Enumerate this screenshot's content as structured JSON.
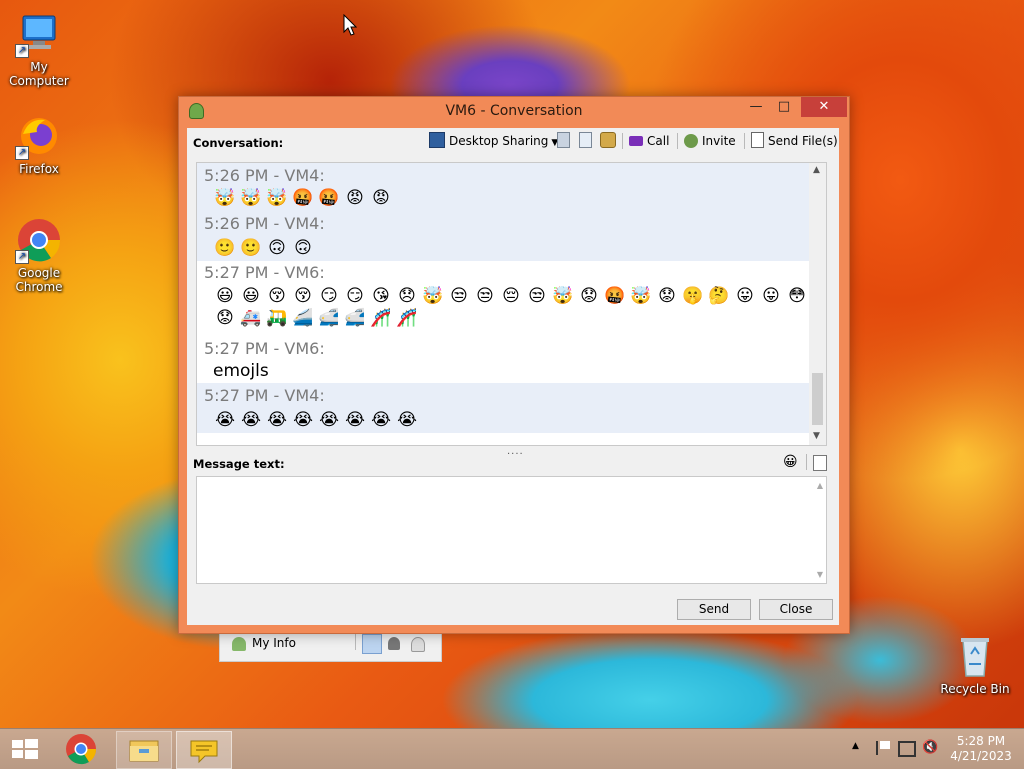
{
  "desktop": {
    "icons": [
      {
        "label": "My Computer",
        "icon": "computer-icon"
      },
      {
        "label": "Firefox",
        "icon": "firefox-icon"
      },
      {
        "label": "Google Chrome",
        "icon": "chrome-icon"
      },
      {
        "label": "Recycle Bin",
        "icon": "recycle-bin-icon"
      }
    ]
  },
  "window": {
    "title": "VM6 - Conversation",
    "conversation_label": "Conversation:",
    "toolbar": {
      "desktop_sharing": "Desktop Sharing",
      "call": "Call",
      "invite": "Invite",
      "send_files": "Send File(s)"
    },
    "messages": [
      {
        "header": "5:26 PM - VM4:",
        "emojis": [
          "🤯",
          "🤯",
          "🤯",
          "🤬",
          "🤬",
          "😡",
          "😡"
        ]
      },
      {
        "header": "5:26 PM - VM4:",
        "emojis": [
          "🙂",
          "🙂",
          "🙃",
          "🙃"
        ]
      },
      {
        "header": "5:27 PM - VM6:",
        "emojis": [
          "😃",
          "😃",
          "😚",
          "😚",
          "😏",
          "😏",
          "😘",
          "😞",
          "🤯",
          "😒",
          "😒",
          "😔",
          "😒",
          "🤯",
          "😟",
          "🤬",
          "🤯",
          "😟",
          "🤫",
          "🤔",
          "😛",
          "😛",
          "😳",
          "😟",
          "🚑",
          "🛺",
          "🚄",
          "🚅",
          "🚅",
          "🎢",
          "🎢"
        ]
      },
      {
        "header": "5:27 PM - VM6:",
        "text": "emojls"
      },
      {
        "header": "5:27 PM - VM4:",
        "emojis": [
          "😭",
          "😭",
          "😭",
          "😭",
          "😭",
          "😭",
          "😭",
          "😭"
        ]
      }
    ],
    "splitter": "....",
    "message_text_label": "Message text:",
    "message_value": "",
    "send_label": "Send",
    "close_label": "Close"
  },
  "buddy_list": {
    "my_info": "My Info"
  },
  "taskbar": {
    "time": "5:28 PM",
    "date": "4/21/2023",
    "apps": [
      "start-icon",
      "chrome-icon",
      "file-explorer-icon",
      "chat-app-icon"
    ]
  }
}
